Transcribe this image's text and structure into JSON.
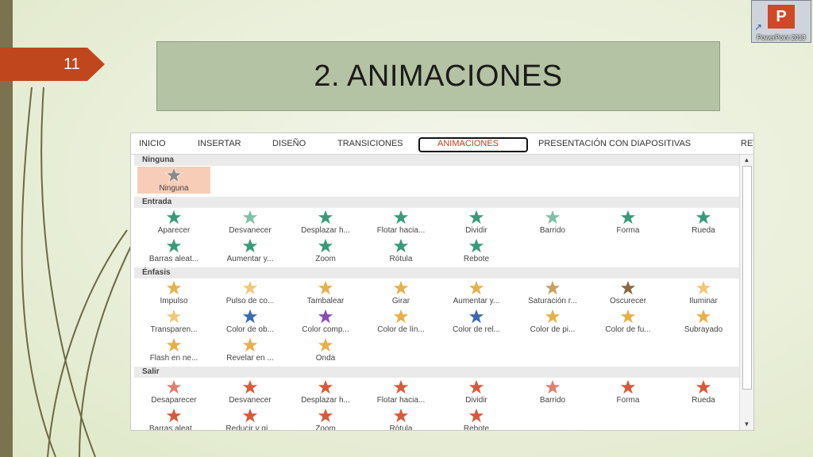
{
  "slide": {
    "number": "11",
    "title": "2. ANIMACIONES"
  },
  "app_icon": {
    "label": "PowerPoint 2013",
    "letter": "P"
  },
  "ribbon": {
    "tabs": [
      "INICIO",
      "INSERTAR",
      "DISEÑO",
      "TRANSICIONES",
      "ANIMACIONES",
      "PRESENTACIÓN CON DIAPOSITIVAS",
      "REV"
    ],
    "active_tab": "ANIMACIONES"
  },
  "gallery": {
    "sections": [
      {
        "name": "Ninguna",
        "items": [
          {
            "label": "Ninguna",
            "color": "#8a8a8a"
          }
        ]
      },
      {
        "name": "Entrada",
        "items": [
          {
            "label": "Aparecer",
            "color": "#3a9a7a"
          },
          {
            "label": "Desvanecer",
            "color": "#7fc0a8"
          },
          {
            "label": "Desplazar h...",
            "color": "#3a9a7a"
          },
          {
            "label": "Flotar hacia...",
            "color": "#3a9a7a"
          },
          {
            "label": "Dividir",
            "color": "#3a9a7a"
          },
          {
            "label": "Barrido",
            "color": "#7fc0a8"
          },
          {
            "label": "Forma",
            "color": "#3a9a7a"
          },
          {
            "label": "Rueda",
            "color": "#3a9a7a"
          },
          {
            "label": "Barras aleat...",
            "color": "#3a9a7a"
          },
          {
            "label": "Aumentar y...",
            "color": "#3a9a7a"
          },
          {
            "label": "Zoom",
            "color": "#3a9a7a"
          },
          {
            "label": "Rótula",
            "color": "#3a9a7a"
          },
          {
            "label": "Rebote",
            "color": "#3a9a7a"
          }
        ]
      },
      {
        "name": "Énfasis",
        "items": [
          {
            "label": "Impulso",
            "color": "#e8b04a"
          },
          {
            "label": "Pulso de co...",
            "color": "#f0c878"
          },
          {
            "label": "Tambalear",
            "color": "#e8b04a"
          },
          {
            "label": "Girar",
            "color": "#e8b04a"
          },
          {
            "label": "Aumentar y...",
            "color": "#e8b04a"
          },
          {
            "label": "Saturación r...",
            "color": "#c8a060"
          },
          {
            "label": "Oscurecer",
            "color": "#8a6a40"
          },
          {
            "label": "Iluminar",
            "color": "#f0c878"
          },
          {
            "label": "Transparen...",
            "color": "#f0c878"
          },
          {
            "label": "Color de ob...",
            "color": "#3a6ab0"
          },
          {
            "label": "Color comp...",
            "color": "#8a4ab0"
          },
          {
            "label": "Color de lín...",
            "color": "#e8b04a"
          },
          {
            "label": "Color de rel...",
            "color": "#3a6ab0"
          },
          {
            "label": "Color de pi...",
            "color": "#e8b04a"
          },
          {
            "label": "Color de fu...",
            "color": "#e8b04a"
          },
          {
            "label": "Subrayado",
            "color": "#e8b04a"
          },
          {
            "label": "Flash en ne...",
            "color": "#e8b04a"
          },
          {
            "label": "Revelar en ...",
            "color": "#e8b04a"
          },
          {
            "label": "Onda",
            "color": "#e8b04a"
          }
        ]
      },
      {
        "name": "Salir",
        "items": [
          {
            "label": "Desaparecer",
            "color": "#e08070"
          },
          {
            "label": "Desvanecer",
            "color": "#d85a3a"
          },
          {
            "label": "Desplazar h...",
            "color": "#d85a3a"
          },
          {
            "label": "Flotar hacia...",
            "color": "#d85a3a"
          },
          {
            "label": "Dividir",
            "color": "#d85a3a"
          },
          {
            "label": "Barrido",
            "color": "#e08070"
          },
          {
            "label": "Forma",
            "color": "#d85a3a"
          },
          {
            "label": "Rueda",
            "color": "#d85a3a"
          },
          {
            "label": "Barras aleat...",
            "color": "#d85a3a"
          },
          {
            "label": "Reducir y gi...",
            "color": "#d85a3a"
          },
          {
            "label": "Zoom",
            "color": "#d85a3a"
          },
          {
            "label": "Rótula",
            "color": "#d85a3a"
          },
          {
            "label": "Rebote",
            "color": "#d85a3a"
          }
        ]
      }
    ],
    "selected_item": "Ninguna"
  },
  "colors": {
    "accent": "#c0461e",
    "title_bg": "#b3c3a3",
    "left_bar": "#7a7350"
  }
}
